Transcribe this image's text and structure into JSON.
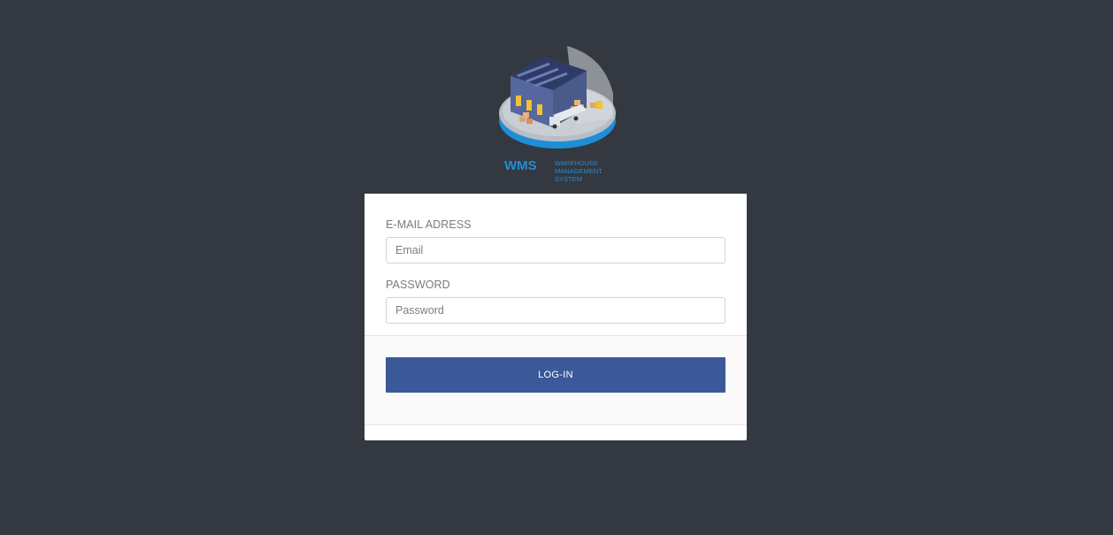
{
  "logo": {
    "brand_abbr": "WMS",
    "brand_line1": "WAREHOUSE",
    "brand_line2": "MANAGEMENT",
    "brand_line3": "SYSTEM",
    "brand_color": "#1e8fd6"
  },
  "form": {
    "email_label": "E-MAIL ADRESS",
    "email_placeholder": "Email",
    "email_value": "",
    "password_label": "PASSWORD",
    "password_placeholder": "Password",
    "password_value": "",
    "submit_label": "LOG-IN"
  },
  "colors": {
    "background": "#343840",
    "button": "#3b5998"
  }
}
